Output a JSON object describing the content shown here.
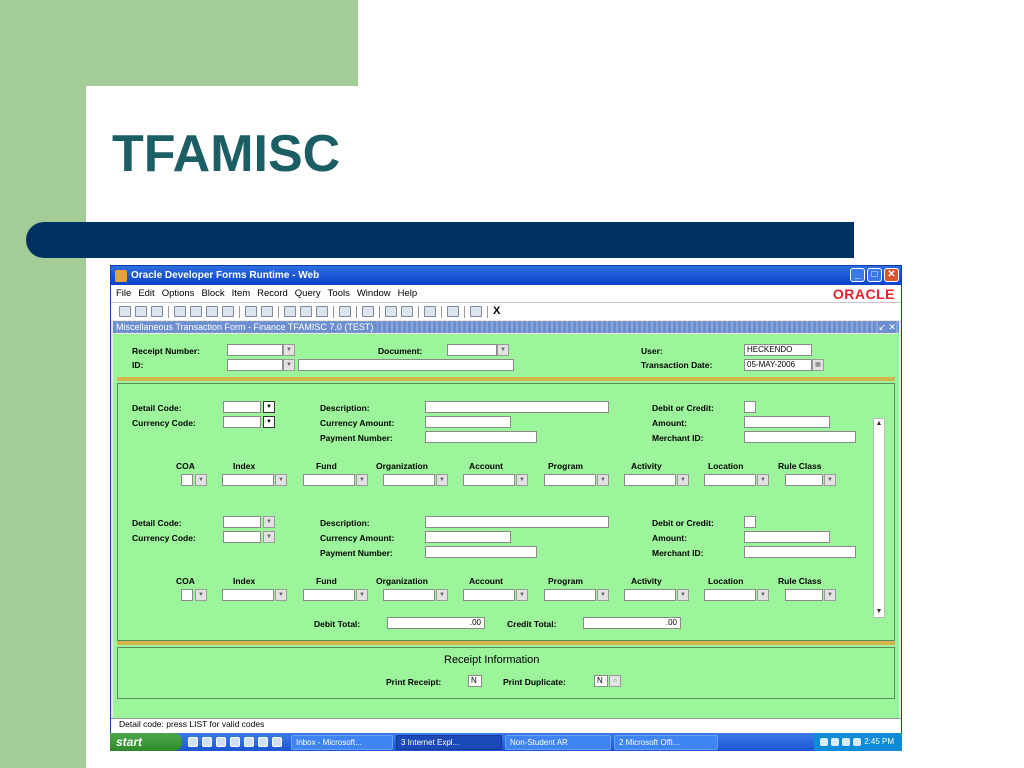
{
  "slide": {
    "title": "TFAMISC"
  },
  "window": {
    "title": "Oracle Developer Forms Runtime - Web",
    "controls": {
      "minimize": "_",
      "maximize": "□",
      "close": "✕"
    },
    "menu": [
      "File",
      "Edit",
      "Options",
      "Block",
      "Item",
      "Record",
      "Query",
      "Tools",
      "Window",
      "Help"
    ],
    "brand": "ORACLE",
    "toolbar_exit": "X"
  },
  "form": {
    "title": "Miscellaneous Transaction Form - Finance  TFAMISC  7.0  (TEST)",
    "title_controls": "↙ ✕",
    "header": {
      "receipt_number_label": "Receipt Number:",
      "id_label": "ID:",
      "document_label": "Document:",
      "user_label": "User:",
      "user_value": "HECKENDO",
      "transaction_date_label": "Transaction Date:",
      "transaction_date_value": "05-MAY-2006"
    },
    "detail": {
      "detail_code_label": "Detail Code:",
      "currency_code_label": "Currency Code:",
      "description_label": "Description:",
      "currency_amount_label": "Currency Amount:",
      "payment_number_label": "Payment Number:",
      "debit_credit_label": "Debit or Credit:",
      "amount_label": "Amount:",
      "merchant_id_label": "Merchant ID:",
      "account_columns": [
        "COA",
        "Index",
        "Fund",
        "Organization",
        "Account",
        "Program",
        "Activity",
        "Location",
        "Rule Class"
      ]
    },
    "totals": {
      "debit_total_label": "Debit Total:",
      "debit_total_value": ".00",
      "credit_total_label": "Credit Total:",
      "credit_total_value": ".00"
    },
    "receipt_info": {
      "title": "Receipt Information",
      "print_receipt_label": "Print Receipt:",
      "print_receipt_value": "N",
      "print_duplicate_label": "Print Duplicate:",
      "print_duplicate_value": "N"
    },
    "status_text": "Detail code: press LIST for valid codes"
  },
  "taskbar": {
    "start_label": "start",
    "tasks": [
      {
        "label": "Inbox - Microsoft...",
        "active": false
      },
      {
        "label": "3 Internet Expl...",
        "active": true
      },
      {
        "label": "Non-Student AR",
        "active": false
      },
      {
        "label": "2 Microsoft Offi...",
        "active": false
      }
    ],
    "clock": "2:45 PM"
  },
  "colors": {
    "slide_green": "#a4cc98",
    "slide_title": "#1b5e64",
    "slide_bar": "#003163",
    "form_background": "#9cf59a",
    "separator": "#d3b64b",
    "oracle_red": "#e4202b"
  }
}
